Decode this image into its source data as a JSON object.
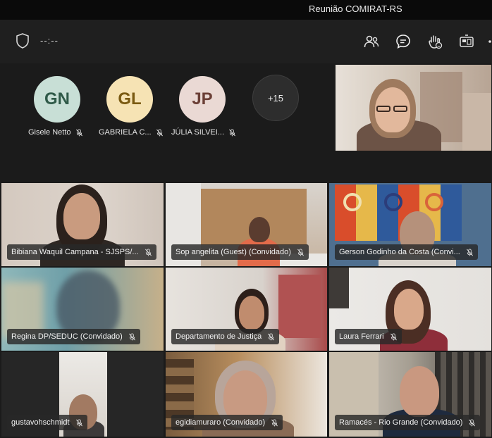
{
  "window": {
    "title": "Reunião COMIRAT-RS"
  },
  "toolbar": {
    "timer": "--:--",
    "icons": [
      "shield-icon",
      "people-icon",
      "chat-icon",
      "raise-hand-icon",
      "share-tray-icon",
      "more-icon"
    ],
    "accent": "#7f85f5"
  },
  "avatars": [
    {
      "initials": "GN",
      "name": "Gisele Netto",
      "bg": "#c8dfd6",
      "fg": "#2f5a48"
    },
    {
      "initials": "GL",
      "name": "GABRIELA C...",
      "bg": "#f6e3b4",
      "fg": "#7a5a12"
    },
    {
      "initials": "JP",
      "name": "JÚLIA SILVEI...",
      "bg": "#ead9d4",
      "fg": "#6b3f36"
    }
  ],
  "overflow": {
    "label": "+15"
  },
  "tiles": [
    {
      "name": "Bibiana Waquil Campana - SJSPS/..."
    },
    {
      "name": "Sop angelita (Guest) (Convidado)"
    },
    {
      "name": "Gerson Godinho da Costa (Convi..."
    },
    {
      "name": "Regina DP/SEDUC (Convidado)"
    },
    {
      "name": "Departamento de Justiça"
    },
    {
      "name": "Laura Ferrari"
    },
    {
      "name": "gustavohschmidt"
    },
    {
      "name": "egidiamuraro (Convidado)"
    },
    {
      "name": "Ramacés - Rio Grande (Convidado)"
    }
  ]
}
